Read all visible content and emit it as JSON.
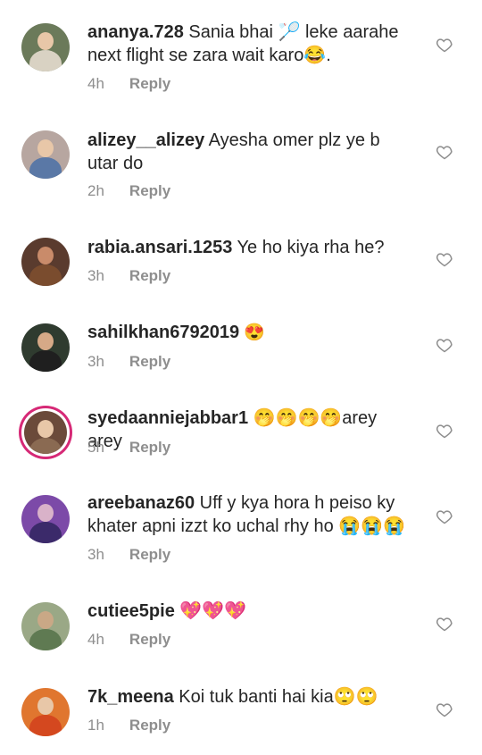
{
  "comments": [
    {
      "username": "ananya.728",
      "text": " Sania bhai 🏸 leke aarahe next flight se zara wait karo😂.",
      "time": "4h",
      "reply": "Reply",
      "avatar_color": "#6b7a5a"
    },
    {
      "username": "alizey__alizey",
      "text": " Ayesha omer plz ye b utar do",
      "time": "2h",
      "reply": "Reply",
      "avatar_color": "#b7a6a0"
    },
    {
      "username": "rabia.ansari.1253",
      "text": " Ye ho kiya rha he?",
      "time": "3h",
      "reply": "Reply",
      "avatar_color": "#5a3b2e"
    },
    {
      "username": "sahilkhan6792019",
      "text": " 😍",
      "time": "3h",
      "reply": "Reply",
      "avatar_color": "#2f3b2f"
    },
    {
      "username": "syedaanniejabbar1",
      "text": " 🤭🤭🤭🤭arey arey",
      "time": "5h",
      "reply": "Reply",
      "avatar_color": "#6b4a3a"
    },
    {
      "username": "areebanaz60",
      "text": " Uff y kya hora h peiso ky khater apni izzt ko uchal rhy ho 😭😭😭",
      "time": "3h",
      "reply": "Reply",
      "avatar_color": "#7c4aa8"
    },
    {
      "username": "cutiee5pie",
      "text": " 💖💖💖",
      "time": "4h",
      "reply": "Reply",
      "avatar_color": "#9aa886"
    },
    {
      "username": "7k_meena",
      "text": " Koi tuk banti hai kia🙄🙄",
      "time": "1h",
      "reply": "Reply",
      "avatar_color": "#e0762f"
    }
  ],
  "colors": {
    "username": "#262626",
    "meta": "#8e8e8e",
    "heart": "#8e8e8e"
  }
}
